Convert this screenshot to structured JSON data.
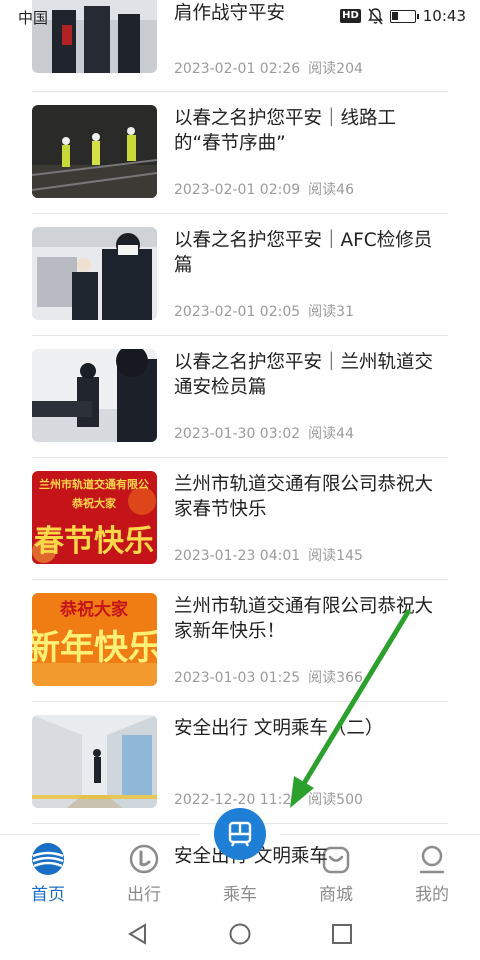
{
  "status_bar": {
    "carrier": "中国",
    "hd": "HD",
    "time": "10:43"
  },
  "news": [
    {
      "title": "以春之名护您平安｜地铁关站开\n肩作战守平安",
      "date": "2023-02-01 02:26",
      "reads": "阅读204"
    },
    {
      "title": "以春之名护您平安｜线路工\n的“春节序曲”",
      "date": "2023-02-01 02:09",
      "reads": "阅读46"
    },
    {
      "title": "以春之名护您平安｜AFC检修员\n篇",
      "date": "2023-02-01 02:05",
      "reads": "阅读31"
    },
    {
      "title": "以春之名护您平安｜兰州轨道交\n通安检员篇",
      "date": "2023-01-30 03:02",
      "reads": "阅读44"
    },
    {
      "title": "兰州市轨道交通有限公司恭祝大\n家春节快乐",
      "date": "2023-01-23 04:01",
      "reads": "阅读145"
    },
    {
      "title": "兰州市轨道交通有限公司恭祝大\n家新年快乐！",
      "date": "2023-01-03 01:25",
      "reads": "阅读366"
    },
    {
      "title": "安全出行 文明乘车（二）",
      "date": "2022-12-20 11:27",
      "reads": "阅读500"
    }
  ],
  "thumb_text": {
    "spring_top": "兰州市轨道交通有限公",
    "spring_sub": "恭祝大家",
    "spring_big": "春节快乐",
    "newyear_top": "恭祝大家",
    "newyear_big": "新年快乐"
  },
  "partial_item_title": "安全出行 文明乘车",
  "tabs": [
    {
      "label": "首页",
      "icon": "home-icon",
      "active": true
    },
    {
      "label": "出行",
      "icon": "travel-icon",
      "active": false
    },
    {
      "label": "乘车",
      "icon": "ride-qr-icon",
      "active": false
    },
    {
      "label": "商城",
      "icon": "shop-icon",
      "active": false
    },
    {
      "label": "我的",
      "icon": "profile-icon",
      "active": false
    }
  ],
  "colors": {
    "accent": "#1a6fc4",
    "fab": "#1f7fd6",
    "annotation_arrow": "#2ca02c"
  }
}
